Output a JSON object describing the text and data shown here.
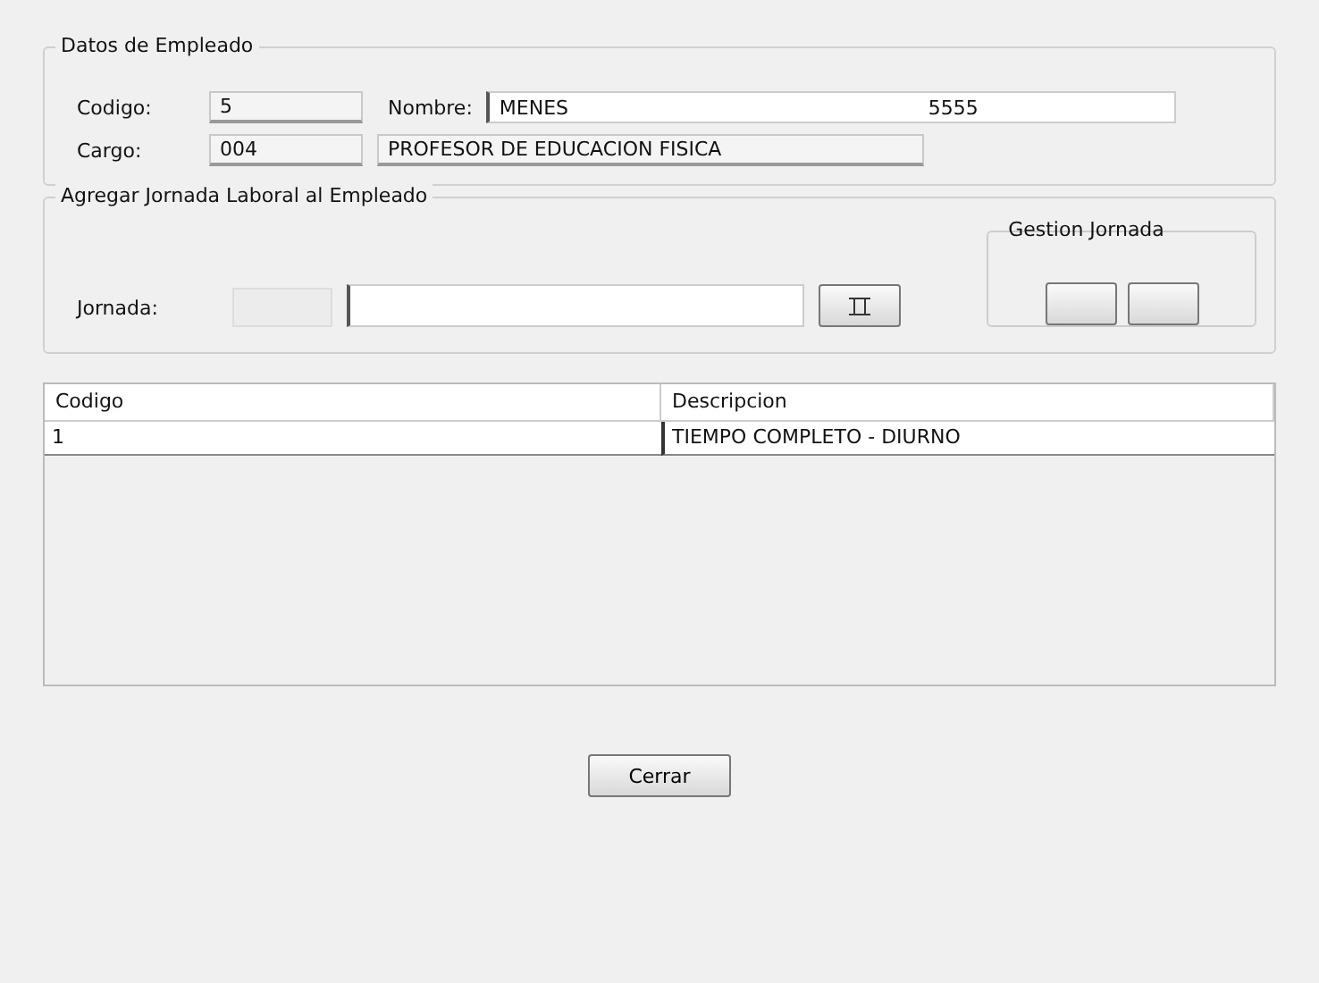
{
  "employee": {
    "title": "Datos de Empleado",
    "code_label": "Codigo:",
    "code": "5",
    "name_label": "Nombre:",
    "first_name": "MENES",
    "last_name": "5555",
    "position_label": "Cargo:",
    "position_code": "004",
    "position_name": "PROFESOR DE EDUCACION FISICA"
  },
  "schedule": {
    "title": "Agregar Jornada Laboral al Empleado",
    "label": "Jornada:",
    "management_title": "Gestion Jornada"
  },
  "table": {
    "columns": [
      "Codigo",
      "Descripcion"
    ],
    "rows": [
      [
        "1",
        "TIEMPO COMPLETO - DIURNO"
      ]
    ]
  },
  "buttons": [
    "Cerrar"
  ]
}
